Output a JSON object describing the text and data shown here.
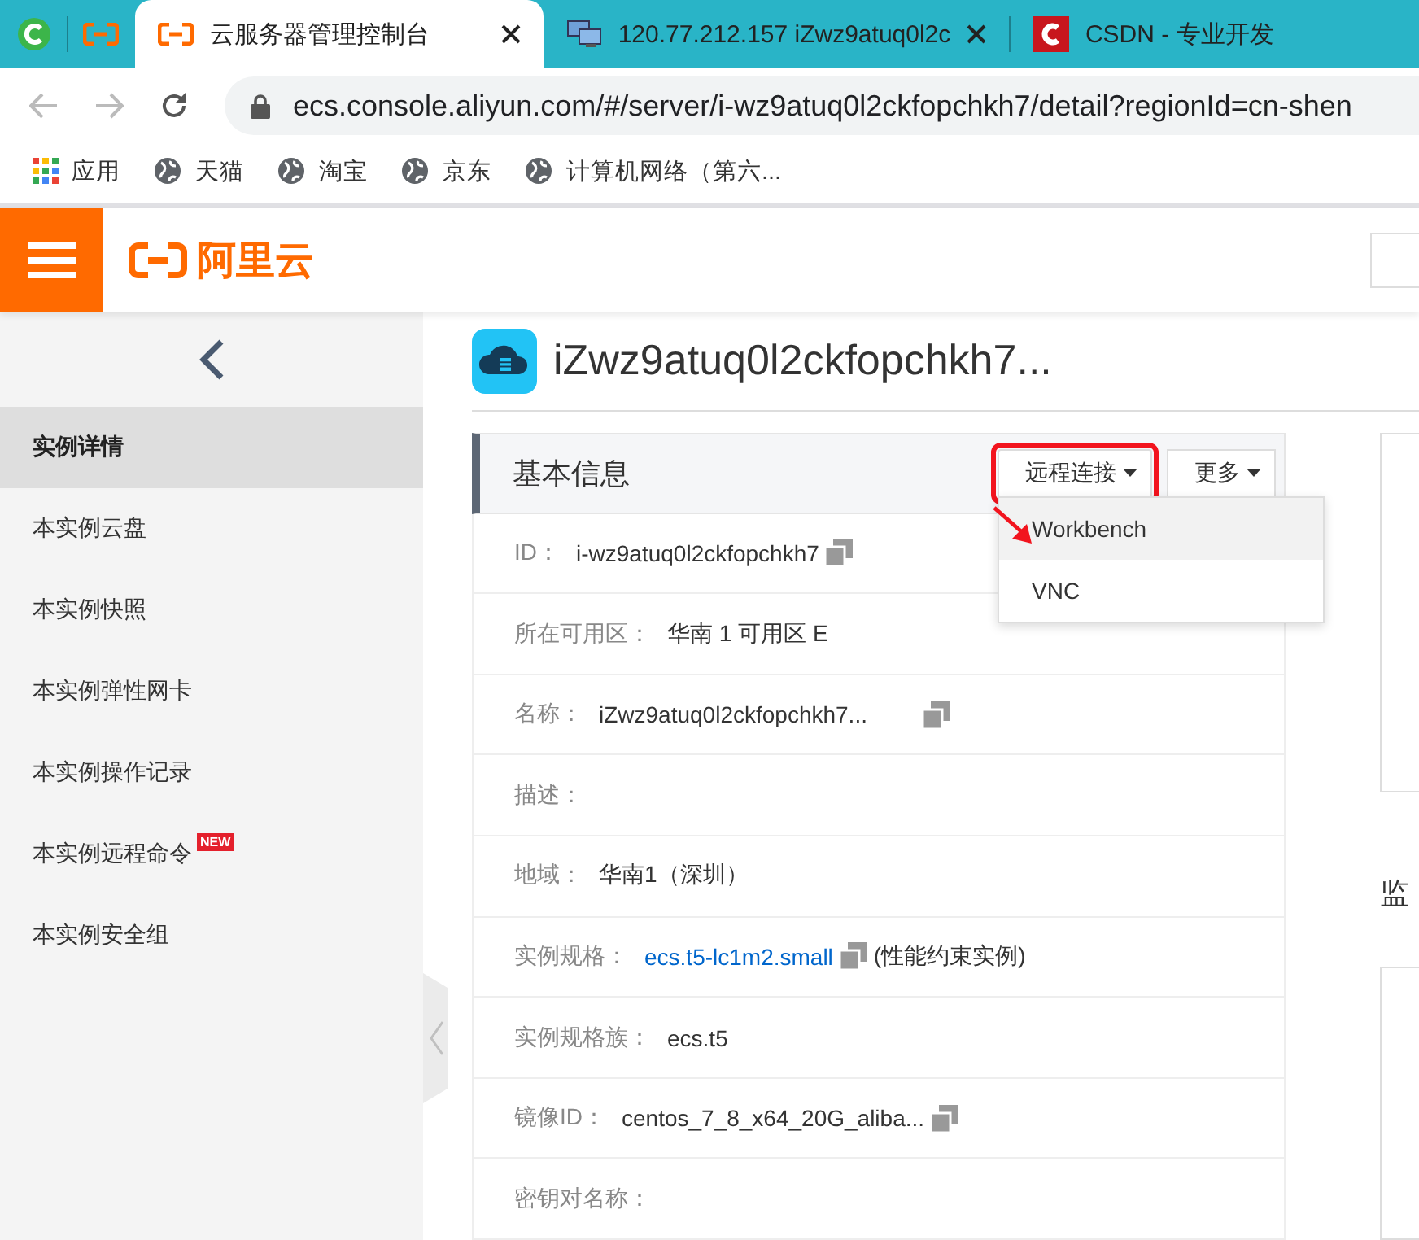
{
  "browser": {
    "tabs": [
      {
        "title": "云服务器管理控制台",
        "selected": true
      },
      {
        "title": "120.77.212.157 iZwz9atuq0l2c",
        "selected": false
      },
      {
        "title": "CSDN - 专业开发",
        "selected": false
      }
    ],
    "url": "ecs.console.aliyun.com/#/server/i-wz9atuq0l2ckfopchkh7/detail?regionId=cn-shen",
    "bookmarks": [
      {
        "kind": "apps",
        "label": "应用"
      },
      {
        "kind": "site",
        "label": "天猫"
      },
      {
        "kind": "site",
        "label": "淘宝"
      },
      {
        "kind": "site",
        "label": "京东"
      },
      {
        "kind": "site",
        "label": "计算机网络（第六..."
      }
    ]
  },
  "header": {
    "logo": "阿里云"
  },
  "sidebar": {
    "items": [
      {
        "label": "实例详情",
        "selected": true
      },
      {
        "label": "本实例云盘",
        "selected": false
      },
      {
        "label": "本实例快照",
        "selected": false
      },
      {
        "label": "本实例弹性网卡",
        "selected": false
      },
      {
        "label": "本实例操作记录",
        "selected": false
      },
      {
        "label": "本实例远程命令",
        "selected": false,
        "badge": "NEW"
      },
      {
        "label": "本实例安全组",
        "selected": false
      }
    ]
  },
  "instance": {
    "title": "iZwz9atuq0l2ckfopchkh7..."
  },
  "panel": {
    "title": "基本信息",
    "buttons": [
      {
        "label": "远程连接",
        "highlighted": true
      },
      {
        "label": "更多",
        "highlighted": false
      }
    ],
    "dropdown": [
      {
        "label": "Workbench",
        "selected": true
      },
      {
        "label": "VNC",
        "selected": false
      }
    ],
    "fields": [
      {
        "label": "ID：",
        "value": "i-wz9atuq0l2ckfopchkh7",
        "kind": "text",
        "copy": true
      },
      {
        "label": "所在可用区：",
        "value": "华南 1 可用区 E",
        "kind": "text",
        "copy": false
      },
      {
        "label": "名称：",
        "value": "iZwz9atuq0l2ckfopchkh7...",
        "kind": "text",
        "copy": true
      },
      {
        "label": "描述：",
        "kind": "text",
        "copy": false
      },
      {
        "label": "地域：",
        "value": "华南1（深圳）",
        "kind": "text",
        "copy": false
      },
      {
        "label": "实例规格：",
        "value": "ecs.t5-lc1m2.small",
        "kind": "link",
        "copy": true,
        "note": "(性能约束实例)"
      },
      {
        "label": "实例规格族：",
        "value": "ecs.t5",
        "kind": "text",
        "copy": false
      },
      {
        "label": "镜像ID：",
        "value": "centos_7_8_x64_20G_aliba...",
        "kind": "text",
        "copy": true
      },
      {
        "label": "密钥对名称：",
        "kind": "text",
        "copy": false
      }
    ]
  },
  "right": {
    "heading": "监"
  }
}
